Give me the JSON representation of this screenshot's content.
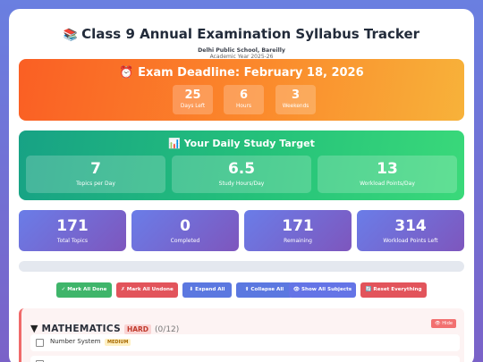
{
  "header": {
    "title_icon": "📚",
    "title": "Class 9 Annual Examination Syllabus Tracker",
    "school": "Delhi Public School, Bareilly",
    "year": "Academic Year 2025-26"
  },
  "deadline": {
    "icon": "⏰",
    "title": "Exam Deadline: February 18, 2026",
    "boxes": [
      {
        "value": "25",
        "label": "Days Left"
      },
      {
        "value": "6",
        "label": "Hours"
      },
      {
        "value": "3",
        "label": "Weekends"
      }
    ]
  },
  "target": {
    "icon": "📊",
    "title": "Your Daily Study Target",
    "boxes": [
      {
        "value": "7",
        "label": "Topics per Day"
      },
      {
        "value": "6.5",
        "label": "Study Hours/Day"
      },
      {
        "value": "13",
        "label": "Workload Points/Day"
      }
    ]
  },
  "stats": [
    {
      "value": "171",
      "label": "Total Topics"
    },
    {
      "value": "0",
      "label": "Completed"
    },
    {
      "value": "171",
      "label": "Remaining"
    },
    {
      "value": "314",
      "label": "Workload Points Left"
    }
  ],
  "progress": {
    "fraction": 0
  },
  "buttons": [
    {
      "label": "✓ Mark All Done",
      "color": "#3fb56a"
    },
    {
      "label": "✗ Mark All Undone",
      "color": "#e2545b"
    },
    {
      "label": "⬇ Expand All",
      "color": "#5b78e0"
    },
    {
      "label": "⬆ Collapse All",
      "color": "#5b78e0"
    },
    {
      "label": "👁 Show All Subjects",
      "color": "#6474e6"
    },
    {
      "label": "🔄 Reset Everything",
      "color": "#e2545b"
    }
  ],
  "subject": {
    "chevron": "▼",
    "name": "MATHEMATICS",
    "difficulty": "HARD",
    "count": "(0/12)",
    "hide_label": "👁 Hide",
    "topics": [
      {
        "name": "Number System",
        "badge": "MEDIUM"
      },
      {
        "name": "",
        "badge": ""
      }
    ]
  }
}
